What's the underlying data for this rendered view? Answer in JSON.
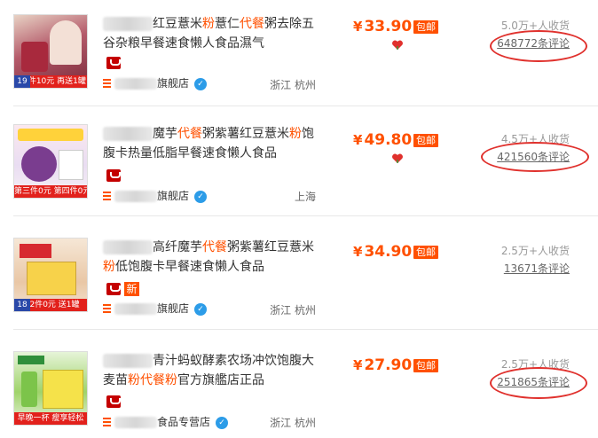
{
  "products": [
    {
      "title_parts": [
        "红豆薏米",
        "粉",
        "薏仁",
        "代餐",
        "粥去除五谷杂粮早餐速食懒人食品濕气"
      ],
      "shop_suffix": "旗舰店",
      "location": "浙江 杭州",
      "price": "33.90",
      "currency": "¥",
      "free_shipping": "包邮",
      "sales": "5.0万+人收货",
      "reviews": "648772条评论",
      "thumb_bar": "第2件10元 再送1罐",
      "thumb_tag": "19"
    },
    {
      "title_parts": [
        "魔芋",
        "代餐",
        "粥紫薯红豆薏米",
        "粉",
        "饱腹卡热量低脂早餐速食懒人食品"
      ],
      "shop_suffix": "旗舰店",
      "location": "上海",
      "price": "49.80",
      "currency": "¥",
      "free_shipping": "包邮",
      "sales": "4.5万+人收货",
      "reviews": "421560条评论",
      "thumb_bar": "第三件0元 第四件0元",
      "thumb_tag": ""
    },
    {
      "title_parts": [
        "高纤魔芋",
        "代餐",
        "粥紫薯红豆薏米",
        "粉",
        "低饱腹卡早餐速食懒人食品"
      ],
      "shop_suffix": "旗舰店",
      "location": "浙江 杭州",
      "price": "34.90",
      "currency": "¥",
      "free_shipping": "包邮",
      "new_tag": "新",
      "sales": "2.5万+人收货",
      "reviews": "13671条评论",
      "thumb_bar": "第2件0元 送1罐",
      "thumb_tag": "18"
    },
    {
      "title_parts": [
        "青汁蚂蚁酵素农场冲饮饱腹大麦苗",
        "粉",
        "代餐",
        "粉",
        "官方旗艦店正品"
      ],
      "shop_suffix": "食品专营店",
      "location": "浙江 杭州",
      "price": "27.90",
      "currency": "¥",
      "free_shipping": "包邮",
      "sales": "2.5万+人收货",
      "reviews": "251865条评论",
      "thumb_bar": "早晚一杯 瘦享轻松",
      "thumb_tag": ""
    }
  ],
  "colors": {
    "accent": "#ff5000",
    "annotation_circle": "#e0312d",
    "tmall_red": "#c40000"
  },
  "icons": [
    "tmall-icon",
    "shop-icon",
    "wangwang-icon",
    "heart-icon"
  ]
}
